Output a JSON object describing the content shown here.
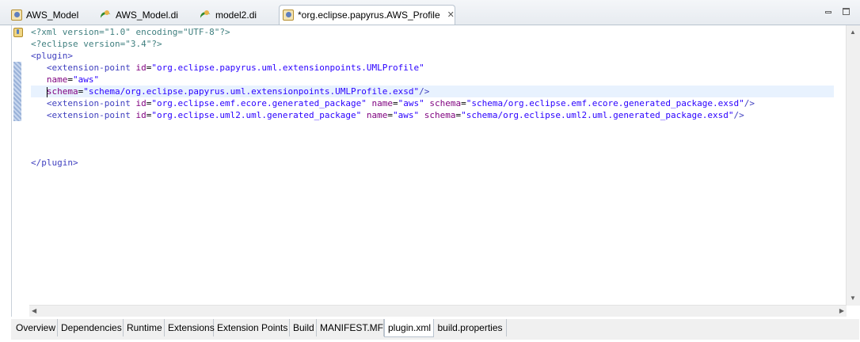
{
  "editor_tabs": [
    {
      "label": "AWS_Model",
      "icon": "profile-icon",
      "active": false
    },
    {
      "label": "AWS_Model.di",
      "icon": "papyrus-diagram-icon",
      "active": false
    },
    {
      "label": "model2.di",
      "icon": "papyrus-diagram-icon",
      "active": false
    },
    {
      "label": "*org.eclipse.papyrus.AWS_Profile",
      "icon": "plugin-manifest-icon",
      "active": true
    }
  ],
  "code_lines": [
    "<?xml version=\"1.0\" encoding=\"UTF-8\"?>",
    "<?eclipse version=\"3.4\"?>",
    "<plugin>",
    "   <extension-point id=\"org.eclipse.papyrus.uml.extensionpoints.UMLProfile\"",
    "   name=\"aws\"",
    "   schema=\"schema/org.eclipse.papyrus.uml.extensionpoints.UMLProfile.exsd\"/>",
    "   <extension-point id=\"org.eclipse.emf.ecore.generated_package\" name=\"aws\" schema=\"schema/org.eclipse.emf.ecore.generated_package.exsd\"/>",
    "   <extension-point id=\"org.eclipse.uml2.uml.generated_package\" name=\"aws\" schema=\"schema/org.eclipse.uml2.uml.generated_package.exsd\"/>",
    "",
    "",
    "",
    "</plugin>"
  ],
  "current_line_index": 5,
  "bottom_tabs": [
    {
      "label": "Overview",
      "active": false
    },
    {
      "label": "Dependencies",
      "active": false
    },
    {
      "label": "Runtime",
      "active": false
    },
    {
      "label": "Extensions",
      "active": false
    },
    {
      "label": "Extension Points",
      "active": false
    },
    {
      "label": "Build",
      "active": false
    },
    {
      "label": "MANIFEST.MF",
      "active": false
    },
    {
      "label": "plugin.xml",
      "active": true
    },
    {
      "label": "build.properties",
      "active": false
    }
  ],
  "colors": {
    "processing_instruction": "#3f7f7f",
    "tag": "#3f3fbf",
    "attribute": "#7f007f",
    "value": "#2a00ff",
    "current_line_highlight": "#e8f2fe"
  }
}
